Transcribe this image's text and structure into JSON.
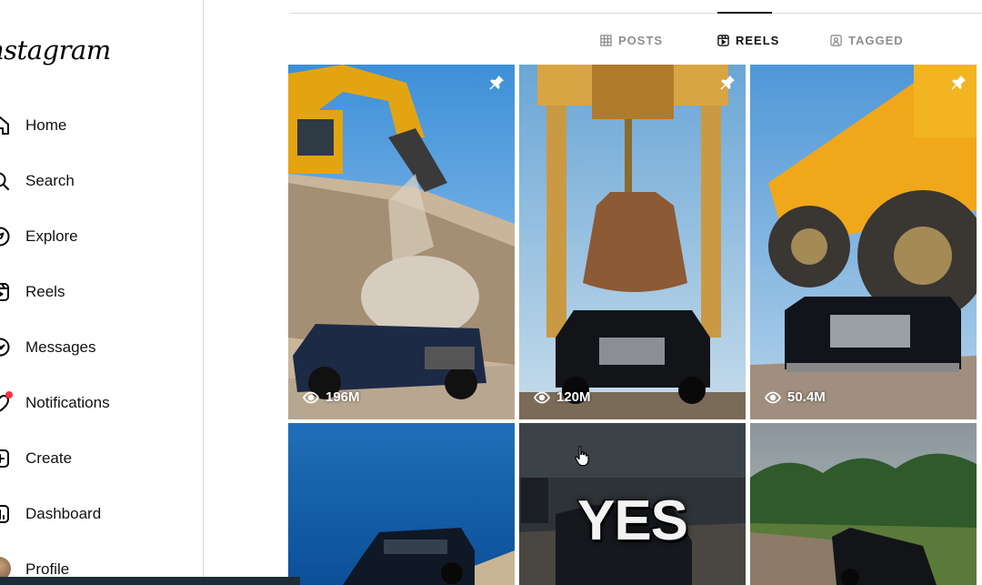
{
  "brand": {
    "logo_text": "nstagram"
  },
  "sidebar": {
    "items": [
      {
        "label": "Home",
        "icon": "home-icon"
      },
      {
        "label": "Search",
        "icon": "search-icon"
      },
      {
        "label": "Explore",
        "icon": "compass-icon"
      },
      {
        "label": "Reels",
        "icon": "reels-icon"
      },
      {
        "label": "Messages",
        "icon": "messenger-icon"
      },
      {
        "label": "Notifications",
        "icon": "heart-icon"
      },
      {
        "label": "Create",
        "icon": "plus-square-icon"
      },
      {
        "label": "Dashboard",
        "icon": "dashboard-icon"
      },
      {
        "label": "Profile",
        "icon": "avatar"
      }
    ]
  },
  "tabs": [
    {
      "label": "POSTS",
      "icon": "grid-icon",
      "active": false
    },
    {
      "label": "REELS",
      "icon": "reels-icon",
      "active": true
    },
    {
      "label": "TAGGED",
      "icon": "tagged-icon",
      "active": false
    }
  ],
  "reels": [
    {
      "views": "196M",
      "pinned": true,
      "scene": "excavator dropping boulder on black Rolls-Royce"
    },
    {
      "views": "120M",
      "pinned": true,
      "scene": "gantry crane lowering rusty weight over black Rolls-Royce"
    },
    {
      "views": "50.4M",
      "pinned": true,
      "scene": "giant yellow dump truck crushing black Rolls-Royce"
    },
    {
      "views": "",
      "pinned": false,
      "scene": "black SUV on cliff above blue sea"
    },
    {
      "views": "",
      "pinned": false,
      "overlay_text": "YES",
      "scene": "dark scene with car"
    },
    {
      "views": "",
      "pinned": false,
      "scene": "black SUV on broken bridge near palm trees"
    }
  ],
  "colors": {
    "notification_dot": "#ff3040",
    "active_tab": "#111111",
    "inactive_tab": "#8e8e8e"
  }
}
